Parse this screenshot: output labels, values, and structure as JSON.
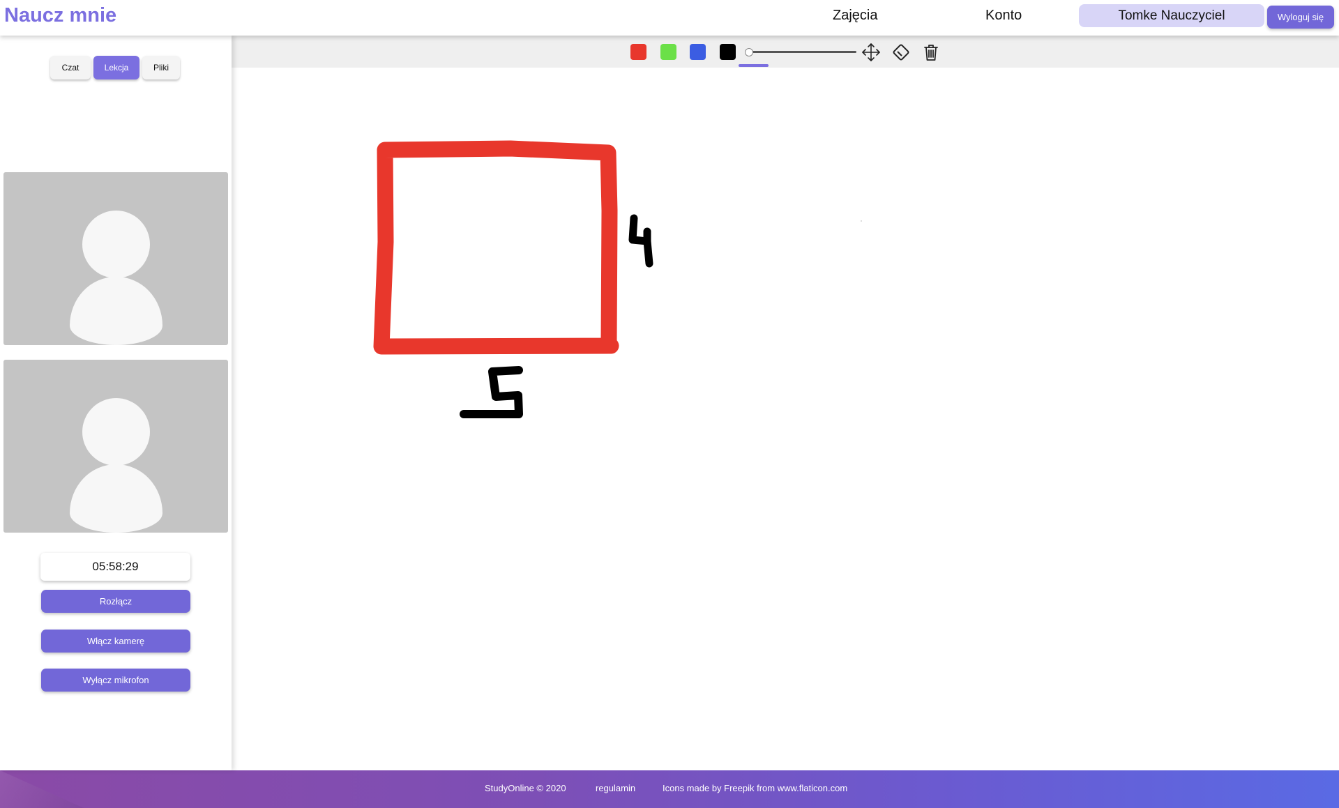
{
  "header": {
    "logo": "Naucz mnie",
    "nav": [
      "Zajęcia",
      "Konto"
    ],
    "user_name": "Tomke Nauczyciel",
    "logout_label": "Wyloguj się"
  },
  "sidebar": {
    "tabs": [
      "Czat",
      "Lekcja",
      "Pliki"
    ],
    "active_tab": "Lekcja",
    "timer": "05:58:29",
    "buttons": {
      "disconnect": "Rozłącz",
      "camera": "Włącz kamerę",
      "mic": "Wyłącz mikrofon"
    }
  },
  "toolbar": {
    "colors": [
      {
        "name": "red",
        "hex": "#e8372c"
      },
      {
        "name": "green",
        "hex": "#6be048"
      },
      {
        "name": "blue",
        "hex": "#3b5de2"
      },
      {
        "name": "black",
        "hex": "#000000"
      }
    ],
    "selected_color": "black",
    "brush_size_level": 0,
    "icons": [
      "move-icon",
      "eraser-icon",
      "trash-icon"
    ]
  },
  "whiteboard": {
    "drawn_labels": [
      "4",
      "5"
    ],
    "accent": "#7b6fe0"
  },
  "footer": {
    "copyright": "StudyOnline © 2020",
    "terms": "regulamin",
    "attribution": "Icons made by Freepik from www.flaticon.com"
  }
}
